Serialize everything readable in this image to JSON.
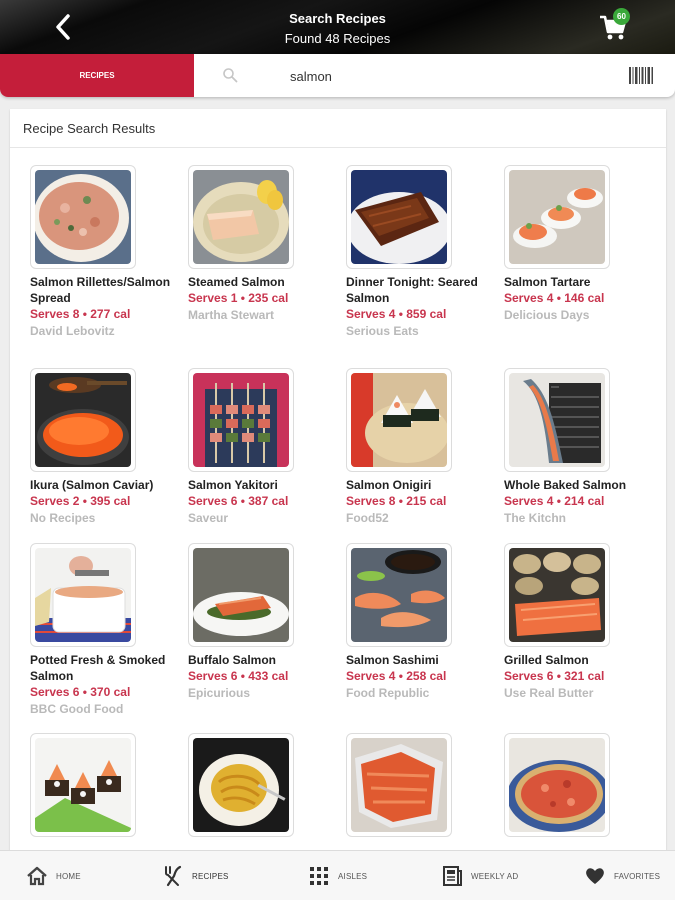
{
  "header": {
    "title": "Search Recipes",
    "subtitle": "Found 48 Recipes",
    "cart_count": "60"
  },
  "search": {
    "tab_label": "RECIPES",
    "query": "salmon"
  },
  "results": {
    "title": "Recipe Search Results",
    "items": [
      {
        "name": "Salmon Rillettes/Salmon Spread",
        "serves": "Serves 8 • 277 cal",
        "source": "David Lebovitz"
      },
      {
        "name": "Steamed Salmon",
        "serves": "Serves 1 • 235 cal",
        "source": "Martha Stewart"
      },
      {
        "name": "Dinner Tonight: Seared Salmon",
        "serves": "Serves 4 • 859 cal",
        "source": "Serious Eats"
      },
      {
        "name": "Salmon Tartare",
        "serves": "Serves 4 • 146 cal",
        "source": "Delicious Days"
      },
      {
        "name": "Ikura (Salmon Caviar)",
        "serves": "Serves 2 • 395 cal",
        "source": "No Recipes"
      },
      {
        "name": "Salmon Yakitori",
        "serves": "Serves 6 • 387 cal",
        "source": "Saveur"
      },
      {
        "name": "Salmon Onigiri",
        "serves": "Serves 8 • 215 cal",
        "source": "Food52"
      },
      {
        "name": "Whole Baked Salmon",
        "serves": "Serves 4 • 214 cal",
        "source": "The Kitchn"
      },
      {
        "name": "Potted Fresh & Smoked Salmon",
        "serves": "Serves 6 • 370 cal",
        "source": "BBC Good Food"
      },
      {
        "name": "Buffalo Salmon",
        "serves": "Serves 6 • 433 cal",
        "source": "Epicurious"
      },
      {
        "name": "Salmon Sashimi",
        "serves": "Serves 4 • 258 cal",
        "source": "Food Republic"
      },
      {
        "name": "Grilled Salmon",
        "serves": "Serves 6 • 321 cal",
        "source": "Use Real Butter"
      },
      {
        "name": "",
        "serves": "",
        "source": ""
      },
      {
        "name": "",
        "serves": "",
        "source": ""
      },
      {
        "name": "",
        "serves": "",
        "source": ""
      },
      {
        "name": "",
        "serves": "",
        "source": ""
      }
    ]
  },
  "nav": {
    "home": "HOME",
    "recipes": "RECIPES",
    "aisles": "AISLES",
    "weekly_ad": "WEEKLY AD",
    "favorites": "FAVORITES"
  },
  "colors": {
    "accent_red": "#c41e3a",
    "serves_text": "#c8354e",
    "badge_green": "#3aa83a"
  }
}
